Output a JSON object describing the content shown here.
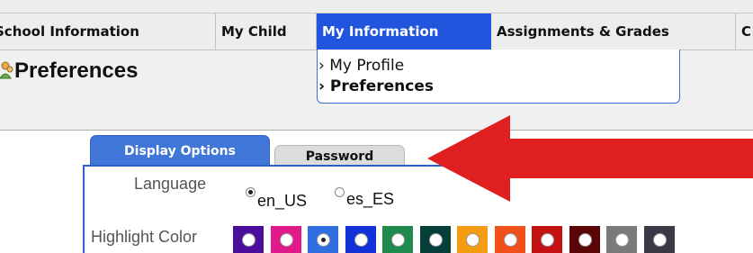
{
  "nav": {
    "tabs": [
      {
        "label": "School Information"
      },
      {
        "label": "My Child"
      },
      {
        "label": "My Information",
        "active": true
      },
      {
        "label": "Assignments & Grades"
      },
      {
        "label": "C"
      }
    ],
    "submenu": [
      {
        "label": "› My Profile",
        "selected": false
      },
      {
        "label": "› Preferences",
        "selected": true
      }
    ]
  },
  "page": {
    "title": "Preferences",
    "icon": "user-icon"
  },
  "pref_tabs": [
    {
      "label": "Display Options",
      "active": true
    },
    {
      "label": "Password",
      "active": false
    }
  ],
  "language": {
    "label": "Language",
    "options": [
      {
        "label": "en_US",
        "selected": true
      },
      {
        "label": "es_ES",
        "selected": false
      }
    ]
  },
  "highlight": {
    "label": "Highlight Color",
    "swatches": [
      {
        "color": "#4b0e9c",
        "selected": false
      },
      {
        "color": "#e01a8a",
        "selected": false
      },
      {
        "color": "#2f6fe0",
        "selected": true
      },
      {
        "color": "#1232d8",
        "selected": false
      },
      {
        "color": "#1f8a4e",
        "selected": false
      },
      {
        "color": "#063f3a",
        "selected": false
      },
      {
        "color": "#f59d12",
        "selected": false
      },
      {
        "color": "#f2501a",
        "selected": false
      },
      {
        "color": "#c41212",
        "selected": false
      },
      {
        "color": "#5a0606",
        "selected": false
      },
      {
        "color": "#7a7a7a",
        "selected": false
      },
      {
        "color": "#3a3a46",
        "selected": false
      }
    ]
  },
  "colors": {
    "nav_active": "#2255dd",
    "tab_active": "#3f76d8",
    "arrow": "#e02020"
  }
}
